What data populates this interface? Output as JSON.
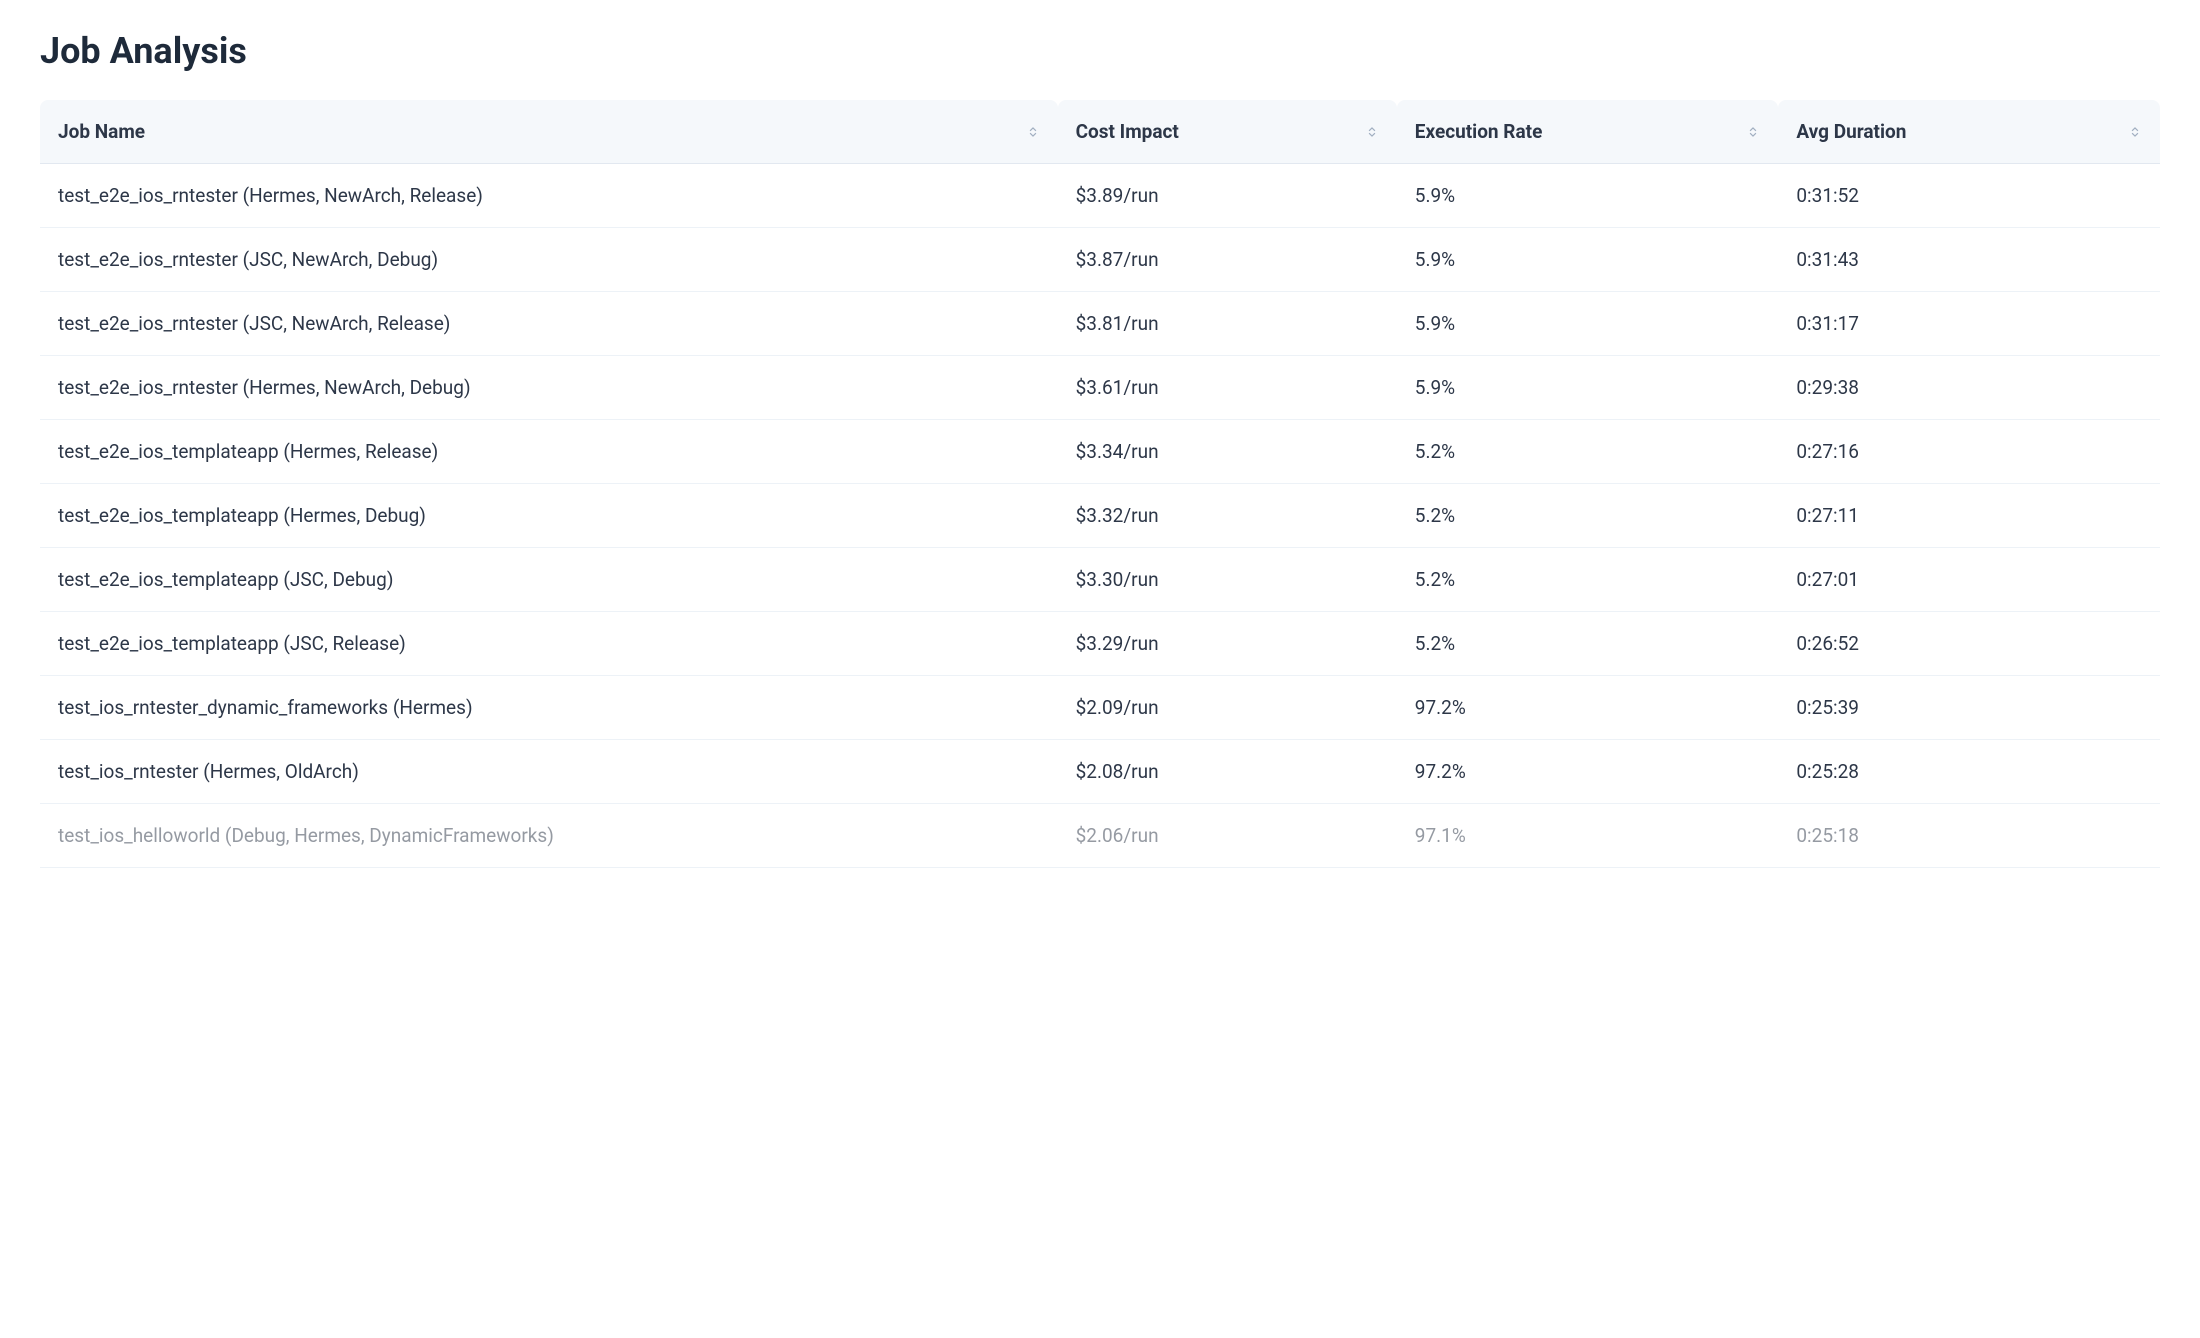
{
  "title": "Job Analysis",
  "columns": {
    "job_name": "Job Name",
    "cost_impact": "Cost Impact",
    "execution_rate": "Execution Rate",
    "avg_duration": "Avg Duration"
  },
  "rows": [
    {
      "job_name": "test_e2e_ios_rntester (Hermes, NewArch, Release)",
      "cost_impact": "$3.89/run",
      "execution_rate": "5.9%",
      "avg_duration": "0:31:52"
    },
    {
      "job_name": "test_e2e_ios_rntester (JSC, NewArch, Debug)",
      "cost_impact": "$3.87/run",
      "execution_rate": "5.9%",
      "avg_duration": "0:31:43"
    },
    {
      "job_name": "test_e2e_ios_rntester (JSC, NewArch, Release)",
      "cost_impact": "$3.81/run",
      "execution_rate": "5.9%",
      "avg_duration": "0:31:17"
    },
    {
      "job_name": "test_e2e_ios_rntester (Hermes, NewArch, Debug)",
      "cost_impact": "$3.61/run",
      "execution_rate": "5.9%",
      "avg_duration": "0:29:38"
    },
    {
      "job_name": "test_e2e_ios_templateapp (Hermes, Release)",
      "cost_impact": "$3.34/run",
      "execution_rate": "5.2%",
      "avg_duration": "0:27:16"
    },
    {
      "job_name": "test_e2e_ios_templateapp (Hermes, Debug)",
      "cost_impact": "$3.32/run",
      "execution_rate": "5.2%",
      "avg_duration": "0:27:11"
    },
    {
      "job_name": "test_e2e_ios_templateapp (JSC, Debug)",
      "cost_impact": "$3.30/run",
      "execution_rate": "5.2%",
      "avg_duration": "0:27:01"
    },
    {
      "job_name": "test_e2e_ios_templateapp (JSC, Release)",
      "cost_impact": "$3.29/run",
      "execution_rate": "5.2%",
      "avg_duration": "0:26:52"
    },
    {
      "job_name": "test_ios_rntester_dynamic_frameworks (Hermes)",
      "cost_impact": "$2.09/run",
      "execution_rate": "97.2%",
      "avg_duration": "0:25:39"
    },
    {
      "job_name": "test_ios_rntester (Hermes, OldArch)",
      "cost_impact": "$2.08/run",
      "execution_rate": "97.2%",
      "avg_duration": "0:25:28"
    },
    {
      "job_name": "test_ios_helloworld (Debug, Hermes, DynamicFrameworks)",
      "cost_impact": "$2.06/run",
      "execution_rate": "97.1%",
      "avg_duration": "0:25:18"
    }
  ]
}
